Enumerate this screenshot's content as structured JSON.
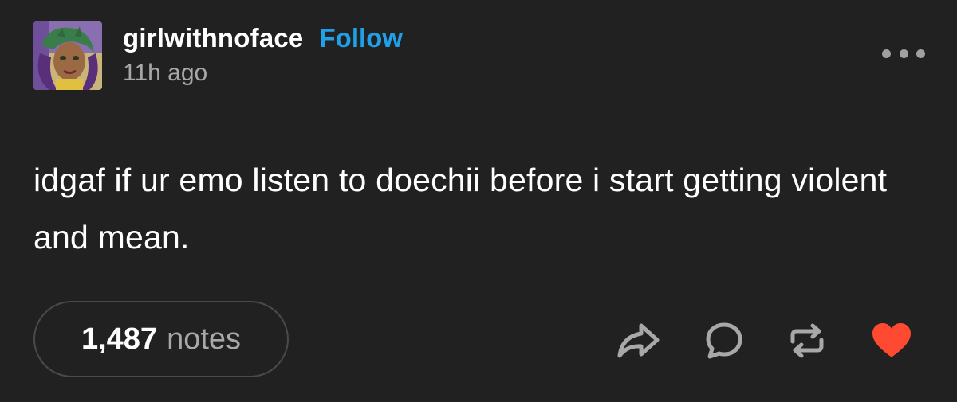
{
  "post": {
    "author": {
      "username": "girlwithnoface",
      "follow_label": "Follow",
      "timestamp": "11h ago"
    },
    "body": "idgaf if ur emo listen to doechii before i start getting violent and mean.",
    "notes": {
      "count": "1,487",
      "label": "notes"
    },
    "actions": [
      {
        "icon": "share-icon"
      },
      {
        "icon": "reply-icon"
      },
      {
        "icon": "reblog-icon"
      },
      {
        "icon": "heart-icon",
        "color": "#ff4930"
      }
    ]
  },
  "colors": {
    "background": "#212121",
    "follow": "#1fa0e8",
    "like": "#ff4930",
    "muted": "#a8a8a8"
  }
}
